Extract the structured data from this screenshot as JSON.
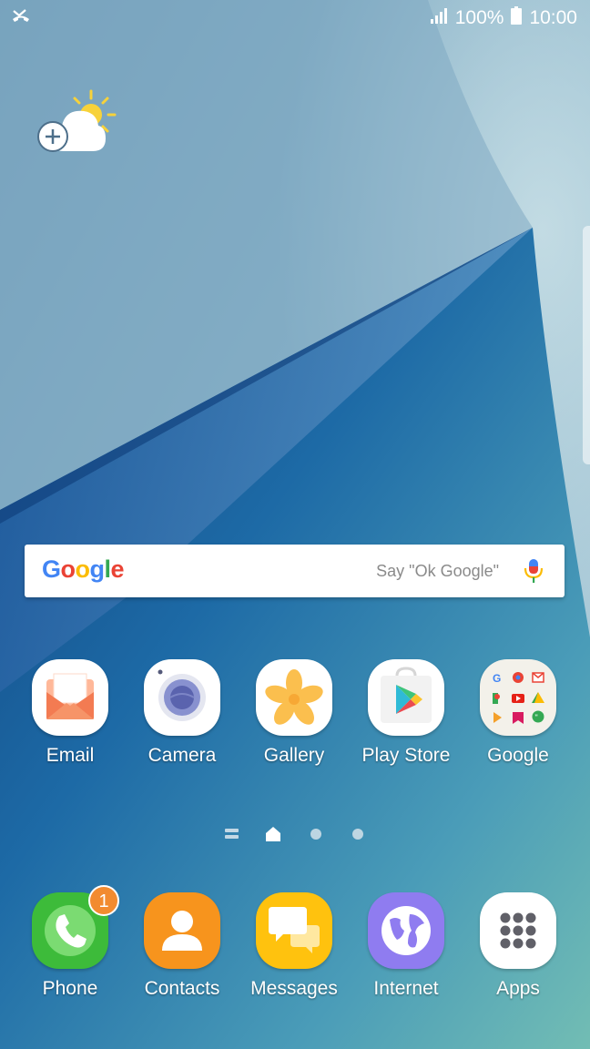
{
  "status_bar": {
    "notification_icon": "missed-call-icon",
    "signal_icon": "cellular-signal-icon",
    "battery_percent": "100%",
    "battery_icon": "battery-full-icon",
    "time": "10:00"
  },
  "weather_widget": {
    "icon": "weather-add-icon"
  },
  "search_bar": {
    "logo": "Google",
    "hint": "Say \"Ok Google\"",
    "mic_icon": "microphone-icon"
  },
  "home_apps": [
    {
      "label": "Email",
      "icon": "email-icon"
    },
    {
      "label": "Camera",
      "icon": "camera-icon"
    },
    {
      "label": "Gallery",
      "icon": "gallery-icon"
    },
    {
      "label": "Play Store",
      "icon": "play-store-icon"
    },
    {
      "label": "Google",
      "icon": "google-folder-icon"
    }
  ],
  "page_indicator": {
    "pages": 4,
    "current": 2
  },
  "dock": [
    {
      "label": "Phone",
      "icon": "phone-icon",
      "badge": "1"
    },
    {
      "label": "Contacts",
      "icon": "contacts-icon"
    },
    {
      "label": "Messages",
      "icon": "messages-icon"
    },
    {
      "label": "Internet",
      "icon": "internet-icon"
    },
    {
      "label": "Apps",
      "icon": "apps-grid-icon"
    }
  ],
  "colors": {
    "phone": "#3dbb3a",
    "contacts": "#f7941d",
    "messages": "#ffc20e",
    "internet": "#8f7cf0",
    "badge": "#f28b30",
    "email_accent": "#f37b52"
  }
}
